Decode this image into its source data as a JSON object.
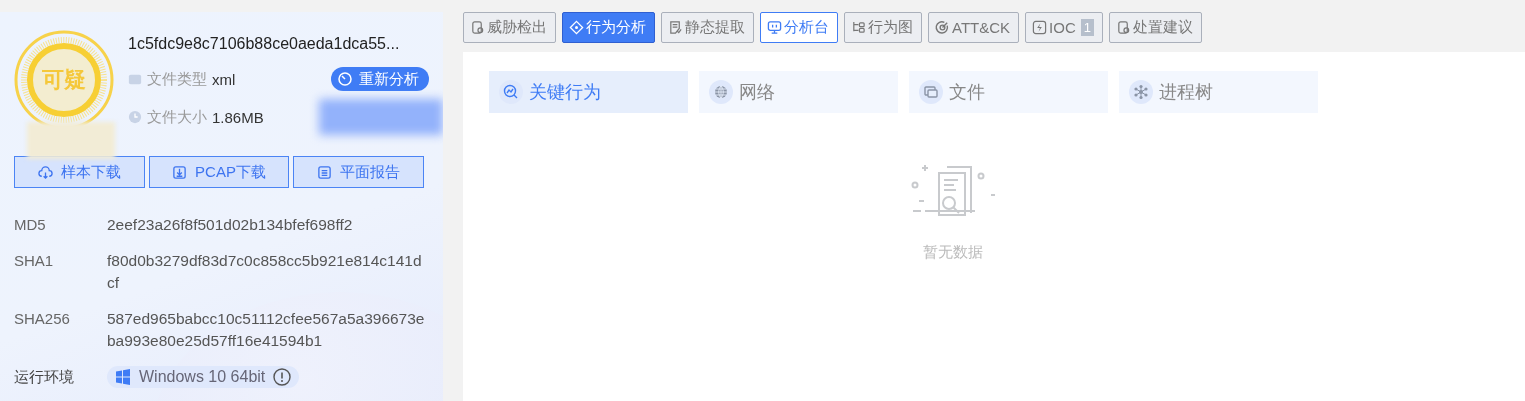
{
  "sample": {
    "verdict": "可疑",
    "file_name": "1c5fdc9e8c7106b88ce0aeda1dca55...",
    "file_type_label": "文件类型",
    "file_type": "xml",
    "file_size_label": "文件大小",
    "file_size": "1.86MB",
    "reanalyze_button": "重新分析"
  },
  "actions": [
    {
      "kind": "cloud",
      "label": "样本下载"
    },
    {
      "kind": "download",
      "label": "PCAP下载"
    },
    {
      "kind": "report",
      "label": "平面报告"
    }
  ],
  "hashes": [
    {
      "label": "MD5",
      "value": "2eef23a26f8f501d02b134bfef698ff2"
    },
    {
      "label": "SHA1",
      "value": "f80d0b3279df83d7c0c858cc5b921e814c141dcf"
    },
    {
      "label": "SHA256",
      "value": "587ed965babcc10c51112cfee567a5a396673eba993e80e25d57ff16e41594b1"
    }
  ],
  "environment": {
    "label": "运行环境",
    "value": "Windows 10 64bit"
  },
  "tabs": [
    {
      "label": "威胁检出",
      "kind": "shield",
      "selected": false,
      "accent": false
    },
    {
      "label": "行为分析",
      "kind": "diamond",
      "selected": true,
      "accent": false
    },
    {
      "label": "静态提取",
      "kind": "doc",
      "selected": false,
      "accent": false
    },
    {
      "label": "分析台",
      "kind": "monitor",
      "selected": false,
      "accent": true
    },
    {
      "label": "行为图",
      "kind": "tree",
      "selected": false,
      "accent": false
    },
    {
      "label": "ATT&CK",
      "kind": "target",
      "selected": false,
      "accent": false
    },
    {
      "label": "IOC",
      "kind": "bolt",
      "selected": false,
      "accent": false,
      "count": "1"
    },
    {
      "label": "处置建议",
      "kind": "shield",
      "selected": false,
      "accent": false
    }
  ],
  "subtabs": [
    {
      "label": "关键行为",
      "kind": "chart",
      "selected": true
    },
    {
      "label": "网络",
      "kind": "globe",
      "selected": false
    },
    {
      "label": "文件",
      "kind": "folder",
      "selected": false
    },
    {
      "label": "进程树",
      "kind": "nodes",
      "selected": false
    }
  ],
  "empty_state": {
    "text": "暂无数据"
  }
}
